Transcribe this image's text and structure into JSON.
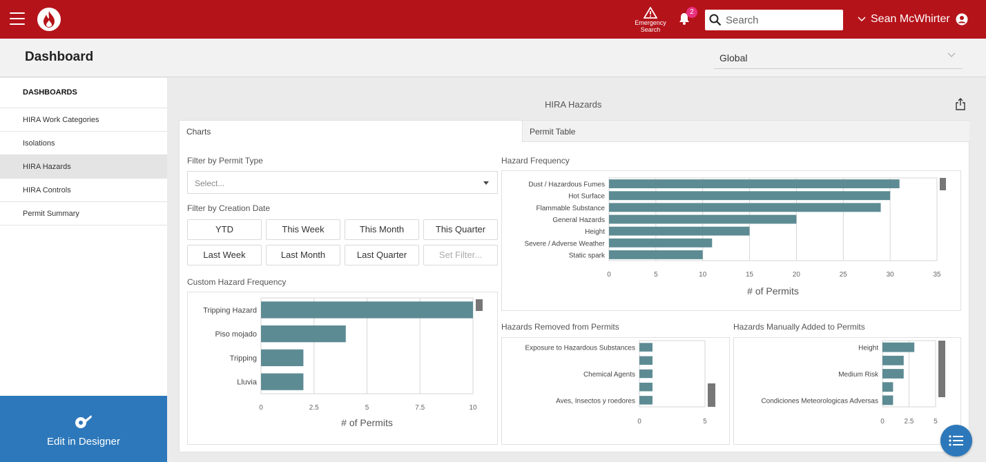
{
  "topbar": {
    "emergency_line1": "Emergency",
    "emergency_line2": "Search",
    "notification_count": "2",
    "search_placeholder": "Search",
    "user_name": "Sean McWhirter",
    "brand_color": "#b5131a"
  },
  "header": {
    "title": "Dashboard",
    "scope_value": "Global"
  },
  "sidebar": {
    "heading": "DASHBOARDS",
    "items": [
      {
        "label": "HIRA Work Categories"
      },
      {
        "label": "Isolations"
      },
      {
        "label": "HIRA Hazards",
        "active": true
      },
      {
        "label": "HIRA Controls"
      },
      {
        "label": "Permit Summary"
      }
    ],
    "designer_label": "Edit in Designer"
  },
  "dashboard": {
    "title": "HIRA Hazards",
    "tabs": [
      {
        "label": "Charts",
        "active": true
      },
      {
        "label": "Permit Table"
      }
    ],
    "filter_permit_type_label": "Filter by Permit Type",
    "filter_permit_type_placeholder": "Select...",
    "filter_date_label": "Filter by Creation Date",
    "date_buttons": [
      "YTD",
      "This Week",
      "This Month",
      "This Quarter",
      "Last Week",
      "Last Month",
      "Last Quarter",
      "Set Filter..."
    ],
    "custom_chart_label": "Custom Hazard Frequency",
    "hazard_frequency_label": "Hazard Frequency",
    "removed_label": "Hazards Removed from Permits",
    "added_label": "Hazards Manually Added to Permits"
  },
  "chart_data": [
    {
      "id": "hazard-frequency",
      "type": "bar",
      "orientation": "horizontal",
      "categories": [
        "Dust / Hazardous Fumes",
        "Hot Surface",
        "Flammable Substance",
        "General Hazards",
        "Height",
        "Severe / Adverse Weather",
        "Static spark"
      ],
      "values": [
        31,
        30,
        29,
        20,
        15,
        11,
        10
      ],
      "xticks": [
        "0",
        "5",
        "10",
        "15",
        "20",
        "25",
        "30",
        "35"
      ],
      "xlabel": "# of Permits",
      "xlim": [
        0,
        35
      ],
      "grid": true,
      "color": "#5d8b93"
    },
    {
      "id": "custom-hazard-frequency",
      "type": "bar",
      "orientation": "horizontal",
      "categories": [
        "Tripping Hazard",
        "Piso mojado",
        "Tripping",
        "Lluvia"
      ],
      "values": [
        10,
        4,
        2,
        2
      ],
      "xticks": [
        "0",
        "2.5",
        "5",
        "7.5",
        "10"
      ],
      "xlabel": "# of Permits",
      "xlim": [
        0,
        10
      ],
      "grid": true,
      "color": "#5d8b93"
    },
    {
      "id": "hazards-removed",
      "type": "bar",
      "orientation": "horizontal",
      "categories": [
        "Exposure to Hazardous Substances",
        "",
        "Chemical Agents",
        "",
        "Aves, Insectos y roedores"
      ],
      "values": [
        1,
        1,
        1,
        1,
        1
      ],
      "xticks": [
        "0",
        "5"
      ],
      "xlim": [
        0,
        5
      ],
      "grid": true,
      "color": "#5d8b93"
    },
    {
      "id": "hazards-added",
      "type": "bar",
      "orientation": "horizontal",
      "categories": [
        "Height",
        "",
        "Medium Risk",
        "",
        "Condiciones Meteorologicas Adversas"
      ],
      "values": [
        3,
        2,
        2,
        1,
        1
      ],
      "xticks": [
        "0",
        "2.5",
        "5"
      ],
      "xlim": [
        0,
        5
      ],
      "grid": true,
      "color": "#5d8b93"
    }
  ]
}
